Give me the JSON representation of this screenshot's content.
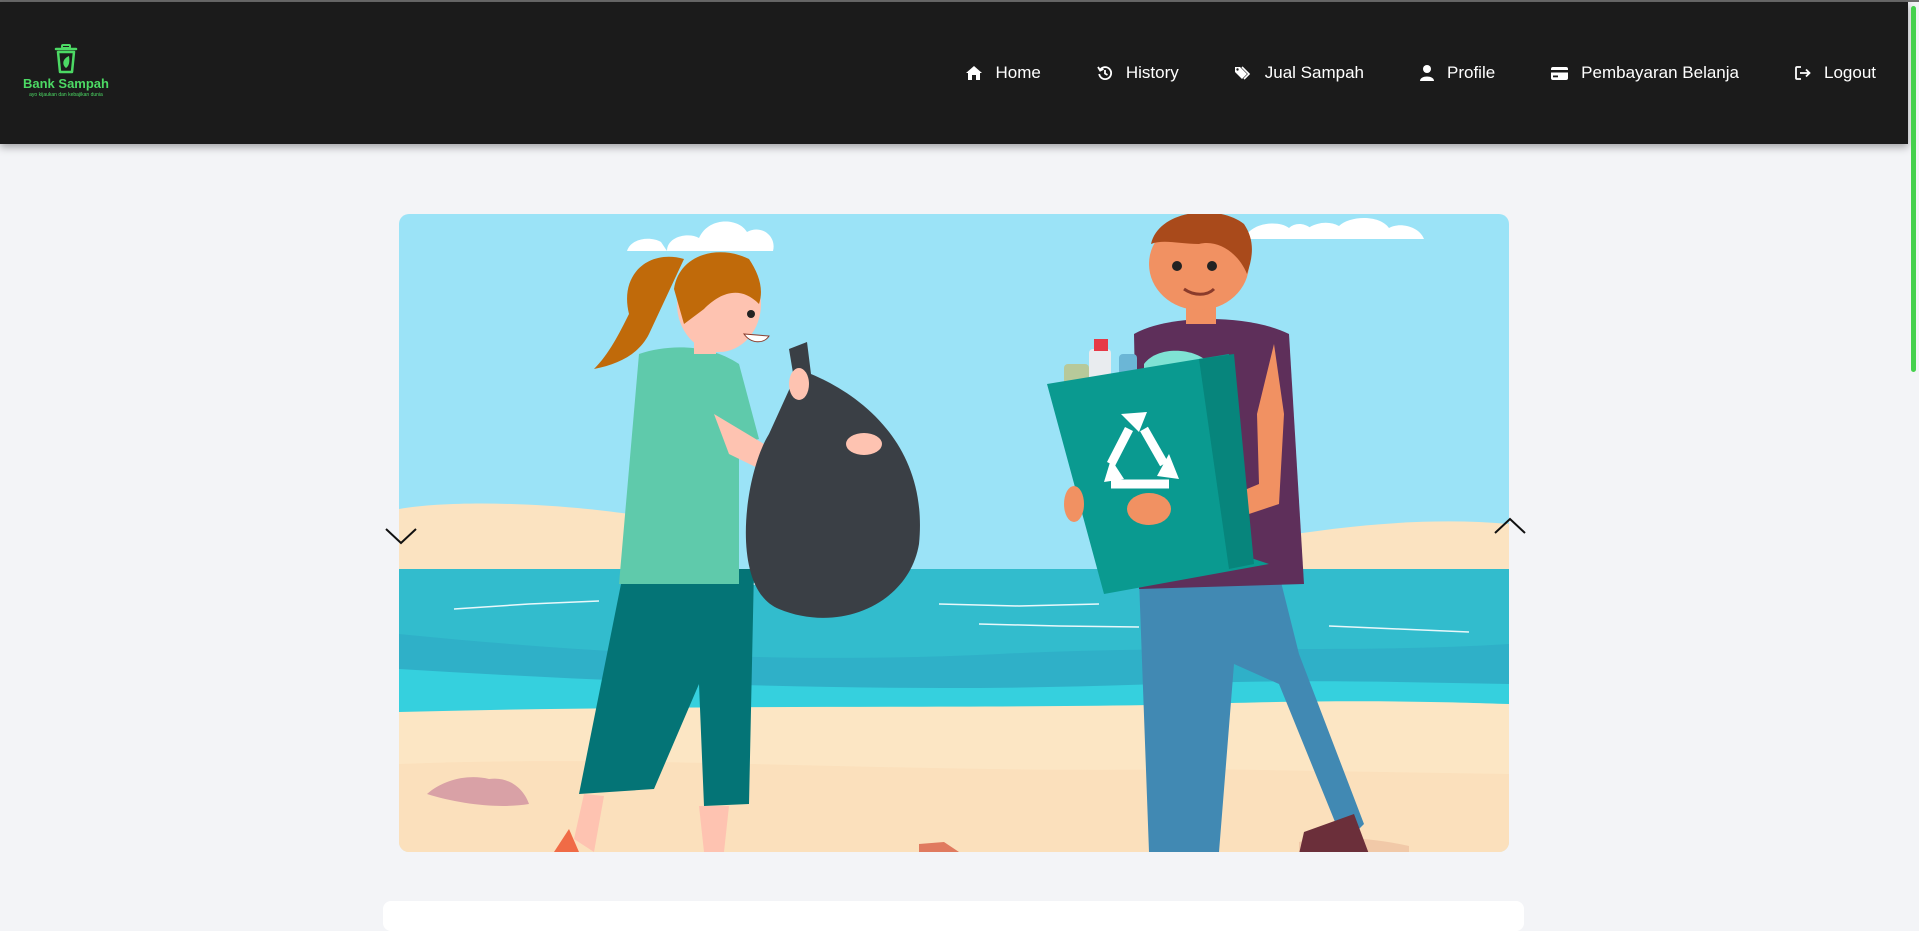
{
  "brand": {
    "title": "Bank Sampah",
    "tagline": "ayo kijaukan dan kebajikan dunia",
    "accent": "#4cd964",
    "icon": "trash-leaf-icon"
  },
  "nav": {
    "items": [
      {
        "label": "Home",
        "icon": "home-icon"
      },
      {
        "label": "History",
        "icon": "history-icon"
      },
      {
        "label": "Jual Sampah",
        "icon": "tags-icon"
      },
      {
        "label": "Profile",
        "icon": "user-icon"
      },
      {
        "label": "Pembayaran Belanja",
        "icon": "credit-card-icon"
      },
      {
        "label": "Logout",
        "icon": "logout-icon"
      }
    ]
  },
  "carousel": {
    "prev_icon": "chevron-down-icon",
    "next_icon": "chevron-up-icon",
    "image": "beach-cleanup-illustration"
  },
  "colors": {
    "navbar_bg": "#1b1b1b",
    "page_bg": "#f3f4f7",
    "scrollbar": "#45d14d"
  }
}
